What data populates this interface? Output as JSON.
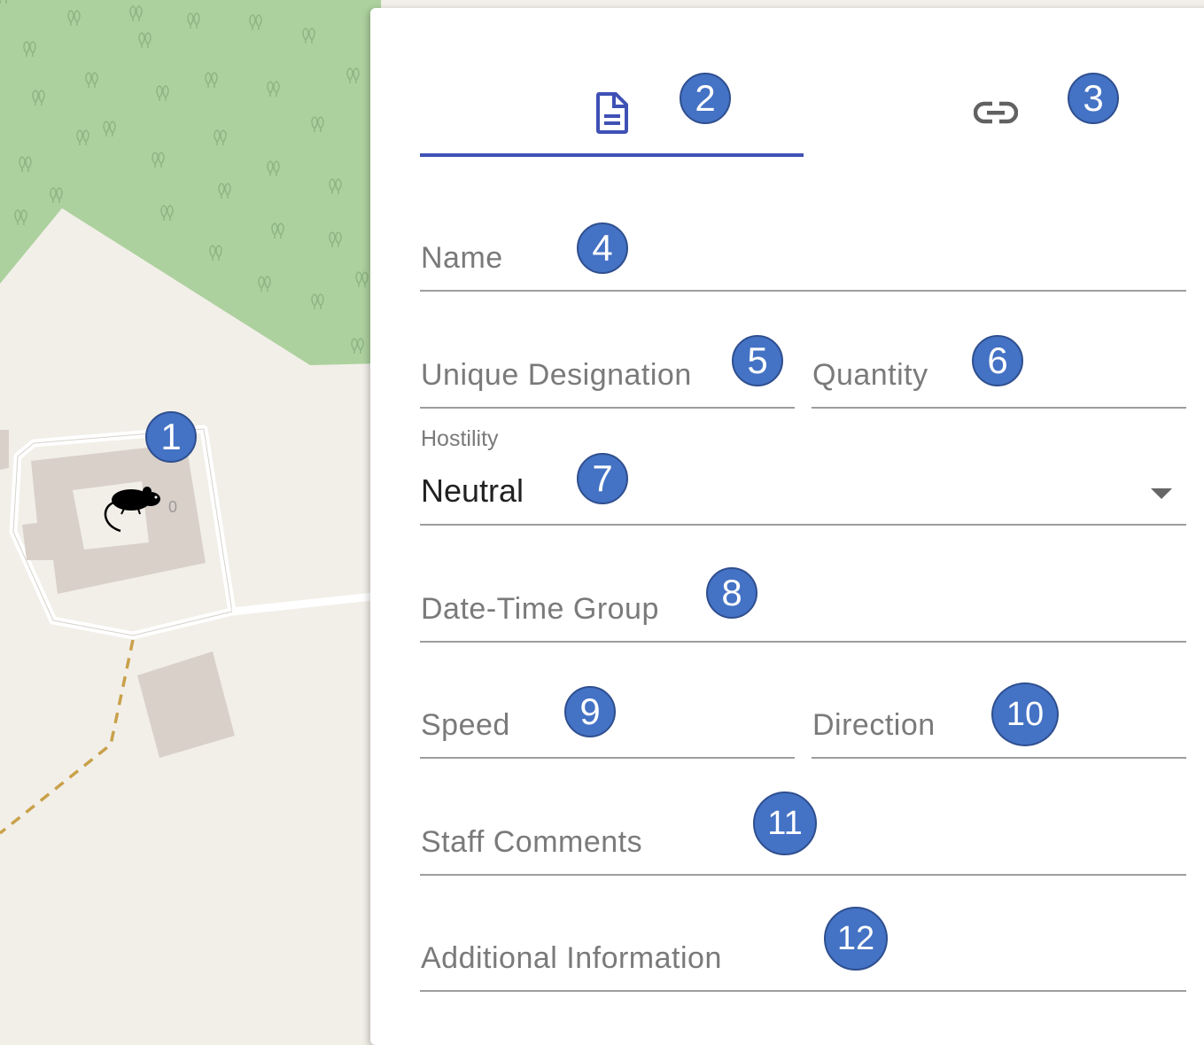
{
  "map": {
    "marker_icon": "rat-icon",
    "marker_label": "0",
    "colors": {
      "background": "#f2efe9",
      "forest": "#add19e",
      "building": "#d9d0c9",
      "road": "#ffffff",
      "path": "#c9a14a"
    }
  },
  "panel": {
    "tabs": [
      {
        "icon": "document-icon",
        "active": true
      },
      {
        "icon": "link-icon",
        "active": false
      }
    ],
    "accent_color": "#3f51b5",
    "fields": {
      "name": {
        "label": "Name",
        "value": ""
      },
      "unique_designation": {
        "label": "Unique Designation",
        "value": ""
      },
      "quantity": {
        "label": "Quantity",
        "value": ""
      },
      "hostility": {
        "label": "Hostility",
        "value": "Neutral"
      },
      "date_time_group": {
        "label": "Date-Time Group",
        "value": ""
      },
      "speed": {
        "label": "Speed",
        "value": ""
      },
      "direction": {
        "label": "Direction",
        "value": ""
      },
      "staff_comments": {
        "label": "Staff Comments",
        "value": ""
      },
      "additional_information": {
        "label": "Additional Information",
        "value": ""
      }
    }
  },
  "callouts": [
    "1",
    "2",
    "3",
    "4",
    "5",
    "6",
    "7",
    "8",
    "9",
    "10",
    "11",
    "12"
  ]
}
